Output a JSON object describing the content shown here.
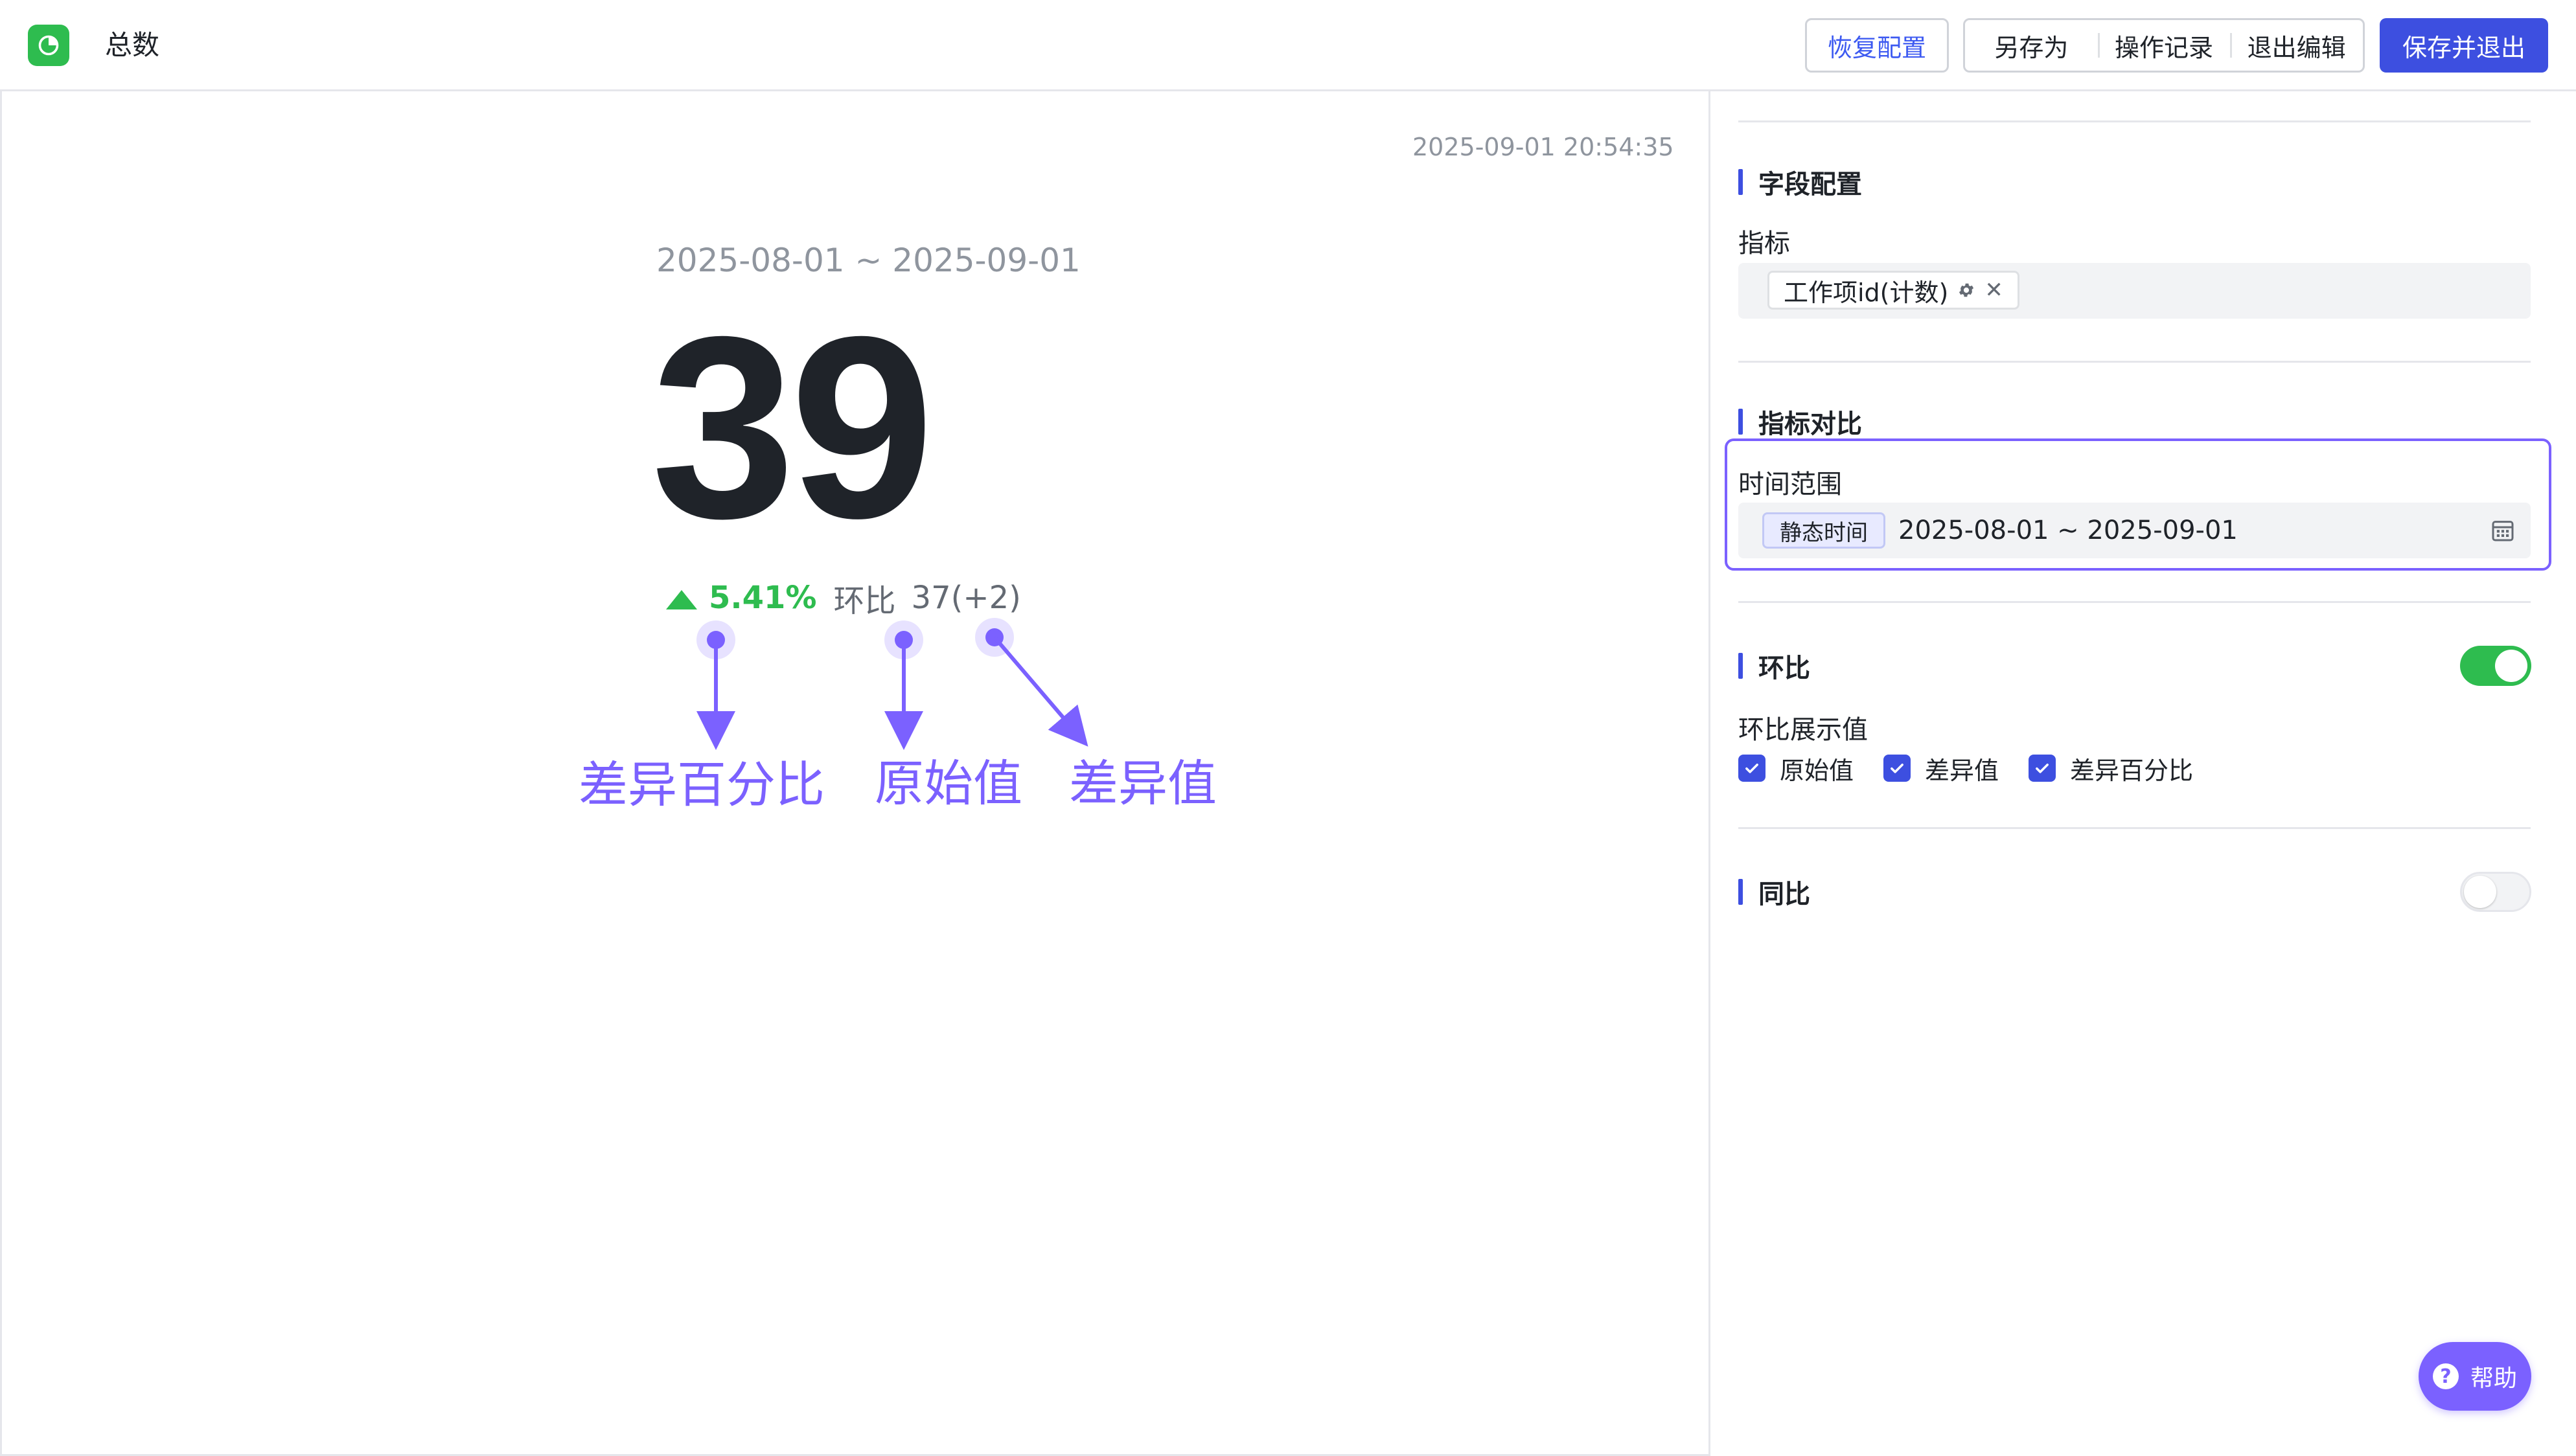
{
  "header": {
    "title": "总数",
    "restore_label": "恢复配置",
    "save_as_label": "另存为",
    "history_label": "操作记录",
    "exit_edit_label": "退出编辑",
    "save_exit_label": "保存并退出"
  },
  "canvas": {
    "timestamp": "2025-09-01 20:54:35",
    "date_range": "2025-08-01 ~ 2025-09-01",
    "value": "39",
    "change_percent": "5.41%",
    "change_direction": "up",
    "mom_label": "环比",
    "mom_value": "37(+2)",
    "annotations": {
      "percent": "差异百分比",
      "original": "原始值",
      "diff": "差异值"
    }
  },
  "panel": {
    "field_config": {
      "title": "字段配置",
      "metric_label": "指标",
      "metric_tag": "工作项id(计数)"
    },
    "comparison": {
      "title": "指标对比",
      "time_range_label": "时间范围",
      "static_tag": "静态时间",
      "range_value": "2025-08-01 ~ 2025-09-01"
    },
    "mom": {
      "title": "环比",
      "enabled": true,
      "display_label": "环比展示值",
      "options": [
        "原始值",
        "差异值",
        "差异百分比"
      ]
    },
    "yoy": {
      "title": "同比",
      "enabled": false
    }
  },
  "help": {
    "label": "帮助"
  },
  "colors": {
    "primary": "#3d4fe0",
    "success": "#2ebc4f",
    "annotation": "#7b61ff",
    "muted": "#8f959e"
  }
}
